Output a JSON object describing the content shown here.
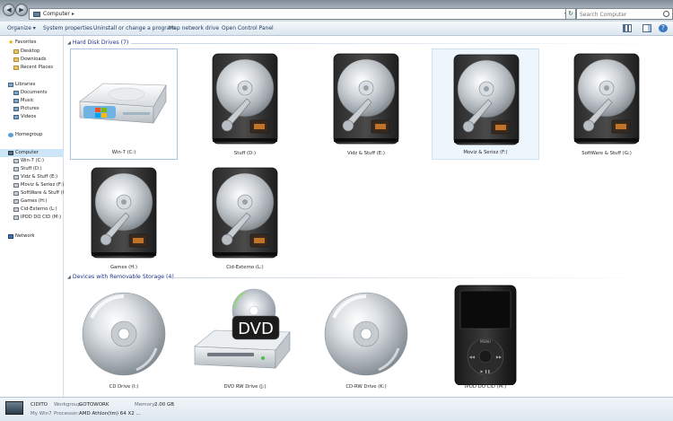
{
  "address": {
    "crumb": "Computer",
    "separator": "▸"
  },
  "search": {
    "placeholder": "Search Computer"
  },
  "toolbar": {
    "organize": "Organize ▾",
    "system_properties": "System properties",
    "uninstall": "Uninstall or change a program",
    "map_drive": "Map network drive",
    "control_panel": "Open Control Panel"
  },
  "nav": {
    "favorites": "Favorites",
    "favorites_items": [
      "Desktop",
      "Downloads",
      "Recent Places"
    ],
    "libraries": "Libraries",
    "libraries_items": [
      "Documents",
      "Music",
      "Pictures",
      "Videos"
    ],
    "homegroup": "Homegroup",
    "computer": "Computer",
    "computer_items": [
      "Win-7 (C:)",
      "Stuff (D:)",
      "Vidz & Stuff (E:)",
      "Moviz & Seriez (F:)",
      "SoftWare & Stuff (G:)",
      "Games (H:)",
      "Cid-Externo (L:)",
      "IPOD DO CID (M:)"
    ],
    "network": "Network"
  },
  "groups": {
    "hdd_title": "Hard Disk Drives (7)",
    "removable_title": "Devices with Removable Storage (4)"
  },
  "hdd": [
    {
      "label": "Win-7 (C:)",
      "icon": "win7-drive-icon"
    },
    {
      "label": "Stuff (D:)",
      "icon": "hard-disk-icon"
    },
    {
      "label": "Vidz & Stuff (E:)",
      "icon": "hard-disk-icon"
    },
    {
      "label": "Moviz & Seriez (F:)",
      "icon": "hard-disk-icon"
    },
    {
      "label": "SoftWare & Stuff (G:)",
      "icon": "hard-disk-icon"
    },
    {
      "label": "Games (H:)",
      "icon": "hard-disk-icon"
    },
    {
      "label": "Cid-Externo (L:)",
      "icon": "hard-disk-icon"
    }
  ],
  "removable": [
    {
      "label": "CD Drive (I:)",
      "icon": "cd-disc-icon"
    },
    {
      "label": "DVD RW Drive (J:)",
      "icon": "dvd-drive-icon",
      "badge": "DVD"
    },
    {
      "label": "CD-RW Drive (K:)",
      "icon": "cd-disc-icon"
    },
    {
      "label": "IPOD DO CID (M:)",
      "icon": "ipod-icon"
    }
  ],
  "details": {
    "name": "CIDITO",
    "sub": "My Win7",
    "workgroup_key": "Workgroup:",
    "workgroup_val": "GOTOWORK",
    "memory_key": "Memory:",
    "memory_val": "2.00 GB",
    "processor_key": "Processor:",
    "processor_val": "AMD Athlon(tm) 64 X2 ..."
  }
}
